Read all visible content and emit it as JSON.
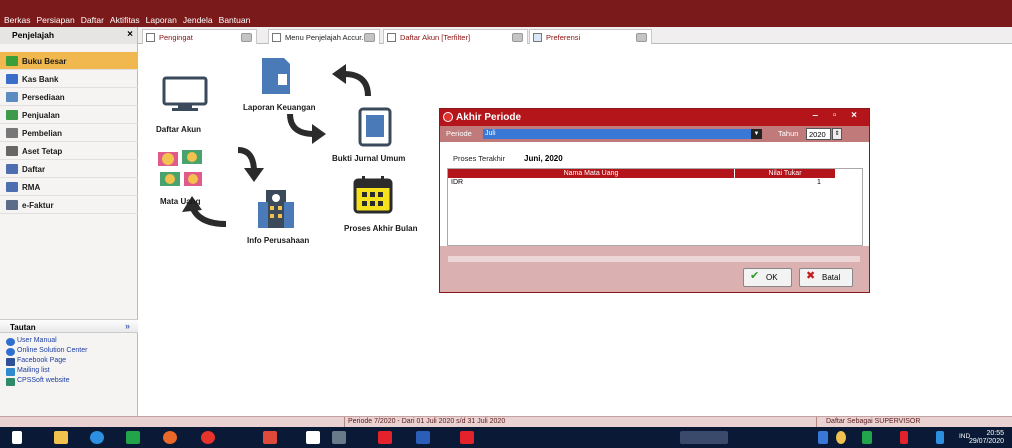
{
  "menu": [
    "Berkas",
    "Persiapan",
    "Daftar",
    "Aktifitas",
    "Laporan",
    "Jendela",
    "Bantuan"
  ],
  "navigator": {
    "title": "Penjelajah",
    "close": "×"
  },
  "tabs": [
    {
      "label": "Pengingat",
      "active": true
    },
    {
      "label": "Menu Penjelajah Accur...",
      "active": false
    },
    {
      "label": "Daftar Akun [Terfilter]",
      "active": true
    },
    {
      "label": "Preferensi",
      "active": true
    }
  ],
  "sidebar": {
    "items": [
      {
        "label": "Buku Besar",
        "active": true,
        "icon": "ledger-icon",
        "color": "#3a9e3a"
      },
      {
        "label": "Kas Bank",
        "active": false,
        "icon": "bank-icon",
        "color": "#3a6fc9"
      },
      {
        "label": "Persediaan",
        "active": false,
        "icon": "inventory-icon",
        "color": "#5a8cc2"
      },
      {
        "label": "Penjualan",
        "active": false,
        "icon": "sales-icon",
        "color": "#3c9a4a"
      },
      {
        "label": "Pembelian",
        "active": false,
        "icon": "cart-icon",
        "color": "#777777"
      },
      {
        "label": "Aset Tetap",
        "active": false,
        "icon": "building-icon",
        "color": "#666666"
      },
      {
        "label": "Daftar",
        "active": false,
        "icon": "list-icon",
        "color": "#4d6fb0"
      },
      {
        "label": "RMA",
        "active": false,
        "icon": "rma-icon",
        "color": "#4d6fb0"
      },
      {
        "label": "e-Faktur",
        "active": false,
        "icon": "efaktur-icon",
        "color": "#5b6b8a"
      }
    ],
    "links_title": "Tautan",
    "links": [
      {
        "label": "User Manual",
        "icon": "help-icon",
        "color": "#2f6fd0"
      },
      {
        "label": "Online Solution Center",
        "icon": "help-icon",
        "color": "#2f6fd0"
      },
      {
        "label": "Facebook Page",
        "icon": "facebook-icon",
        "color": "#2f4f96"
      },
      {
        "label": "Mailing list",
        "icon": "mailing-icon",
        "color": "#2f8ad0"
      },
      {
        "label": "CPSSoft website",
        "icon": "website-icon",
        "color": "#2f8a6a"
      }
    ]
  },
  "flow": {
    "daftar_akun": "Daftar Akun",
    "laporan_keuangan": "Laporan Keuangan",
    "bukti_jurnal_umum": "Bukti Jurnal Umum",
    "mata_uang": "Mata Uang",
    "info_perusahaan": "Info Perusahaan",
    "proses_akhir_bulan": "Proses Akhir Bulan"
  },
  "dialog": {
    "title": "Akhir Periode",
    "controls": "– ▫ ×",
    "periode_label": "Periode",
    "periode_value": "Juli",
    "tahun_label": "Tahun",
    "tahun_value": "2020",
    "proses_terakhir_label": "Proses Terakhir",
    "proses_terakhir_value": "Juni, 2020",
    "grid": {
      "columns": [
        "Nama Mata Uang",
        "Nilai Tukar"
      ],
      "rows": [
        [
          "IDR",
          "1"
        ]
      ]
    },
    "ok_label": "OK",
    "cancel_label": "Batal"
  },
  "status": {
    "periode": "Periode 7/2020 - Dari 01 Juli 2020 s/d 31 Juli 2020",
    "user": "Daftar Sebagai SUPERVISOR"
  },
  "taskbar": {
    "lang": "IND",
    "time": "20:55",
    "date": "29/07/2020"
  }
}
